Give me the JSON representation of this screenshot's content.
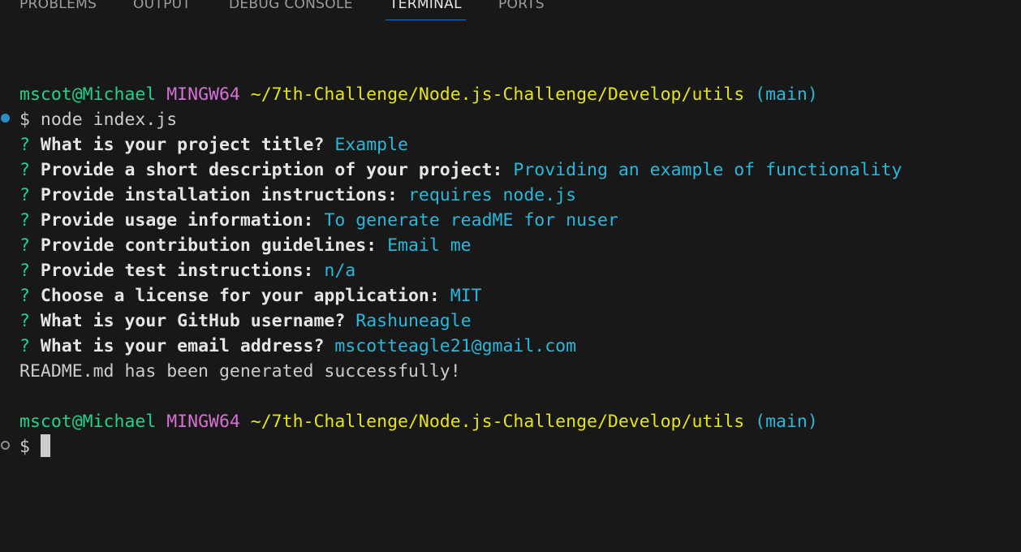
{
  "panel": {
    "tabs": [
      {
        "label": "PROBLEMS"
      },
      {
        "label": "OUTPUT"
      },
      {
        "label": "DEBUG CONSOLE"
      },
      {
        "label": "TERMINAL"
      },
      {
        "label": "PORTS"
      }
    ],
    "active_tab": "TERMINAL"
  },
  "prompt": {
    "user_host": "mscot@Michael",
    "shell": "MINGW64",
    "path": "~/7th-Challenge/Node.js-Challenge/Develop/utils",
    "branch": "(main)",
    "symbol": "$"
  },
  "command": "node index.js",
  "qa": [
    {
      "q": "What is your project title?",
      "a": "Example"
    },
    {
      "q": "Provide a short description of your project:",
      "a": "Providing an example of functionality"
    },
    {
      "q": "Provide installation instructions:",
      "a": "requires node.js"
    },
    {
      "q": "Provide usage information:",
      "a": "To generate readME for nuser"
    },
    {
      "q": "Provide contribution guidelines:",
      "a": "Email me"
    },
    {
      "q": "Provide test instructions:",
      "a": "n/a"
    },
    {
      "q": "Choose a license for your application:",
      "a": "MIT"
    },
    {
      "q": "What is your GitHub username?",
      "a": "Rashuneagle"
    },
    {
      "q": "What is your email address?",
      "a": "mscotteagle21@gmail.com"
    }
  ],
  "question_mark": "?",
  "result": "README.md has been generated successfully!",
  "colors": {
    "background": "#181818",
    "user_host": "#23d18b",
    "shell": "#d670d6",
    "path": "#e5e510",
    "branch": "#29b8db",
    "answer": "#29b8db",
    "active_tab_underline": "#0078d4"
  },
  "icons": {
    "command_success": "filled-circle-decoration",
    "command_pending": "hollow-circle-decoration"
  }
}
